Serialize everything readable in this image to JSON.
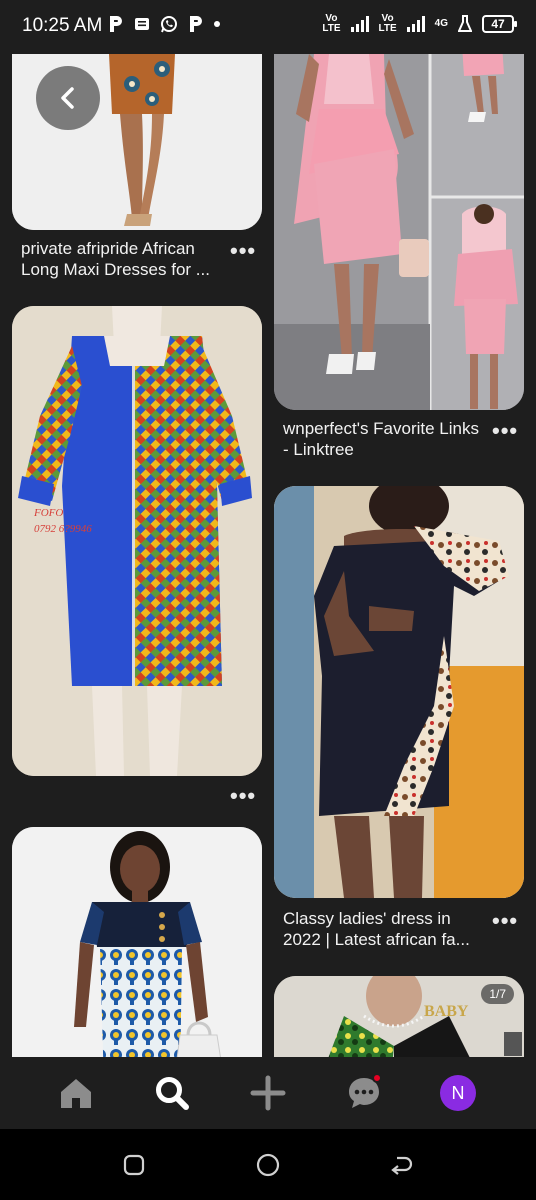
{
  "status_bar": {
    "time": "10:25 AM",
    "notif_icons": [
      "pinterest-icon",
      "message-icon",
      "whatsapp-icon",
      "pinterest-icon"
    ],
    "volte1": "Vo LTE",
    "volte2": "Vo LTE",
    "network": "4G",
    "battery": "47"
  },
  "feed": {
    "pins": [
      {
        "caption": "private afripride African Long Maxi Dresses for ...",
        "image": "woman-legs-african-print-skirt"
      },
      {
        "caption": "wnperfect's Favorite Links - Linktree",
        "image": "pink-peplum-dress-collage"
      },
      {
        "caption": "",
        "image": "blue-ankara-zipper-dress",
        "watermark": "FOFO 0792 6?9946"
      },
      {
        "caption": "Classy ladies' dress in 2022 | Latest african fa...",
        "image": "navy-off-shoulder-ankara-dress"
      },
      {
        "caption": "",
        "image": "navy-yellow-print-dress"
      },
      {
        "caption": "",
        "image": "green-black-ankara-dress",
        "counter": "1/7",
        "logo_text": "BABY"
      }
    ],
    "more_label": "•••"
  },
  "bottom_nav": {
    "items": [
      "home-icon",
      "search-icon",
      "create-icon",
      "messages-icon",
      "profile-avatar"
    ],
    "avatar_letter": "N",
    "accent": "#e60023",
    "avatar_color": "#8a2be2"
  },
  "system_nav": [
    "recents-icon",
    "home-circle-icon",
    "back-icon"
  ]
}
